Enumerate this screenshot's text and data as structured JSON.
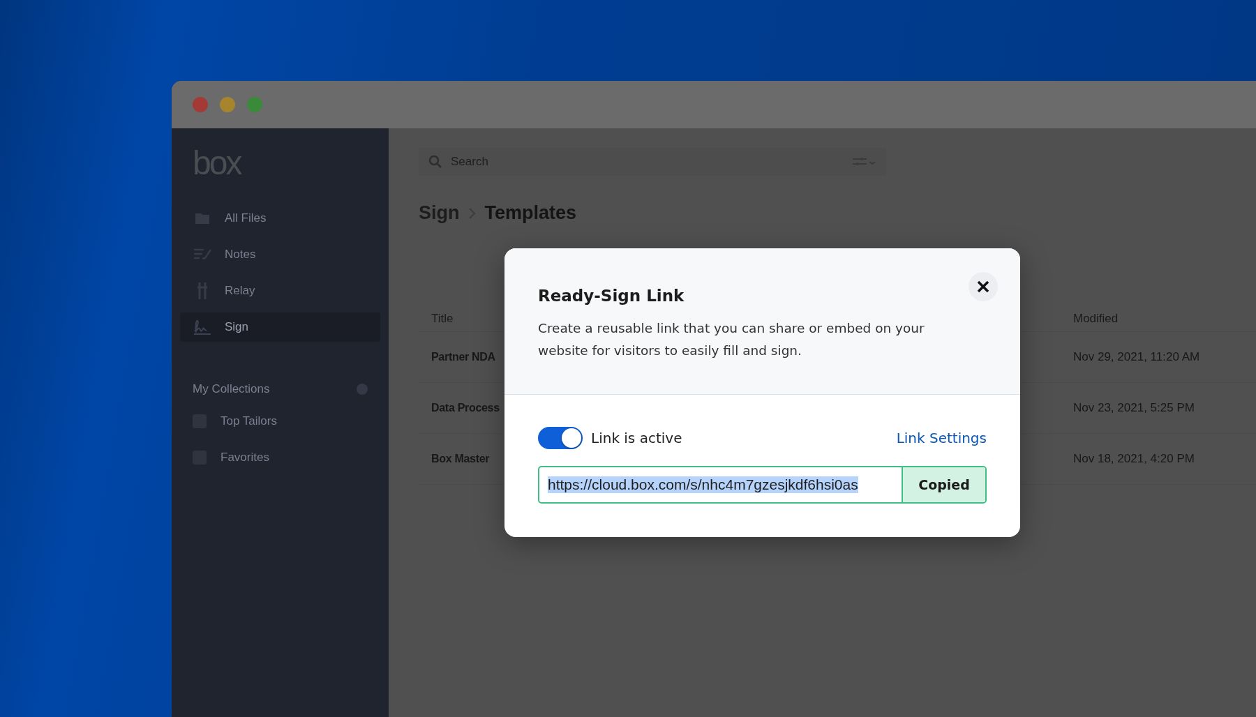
{
  "sidebar": {
    "logo": "box",
    "items": [
      {
        "label": "All Files",
        "selected": false
      },
      {
        "label": "Notes",
        "selected": false
      },
      {
        "label": "Relay",
        "selected": false
      },
      {
        "label": "Sign",
        "selected": true
      }
    ],
    "collections": {
      "title": "My Collections",
      "items": [
        {
          "label": "Top Tailors"
        },
        {
          "label": "Favorites"
        }
      ]
    }
  },
  "main": {
    "search": {
      "placeholder": "Search"
    },
    "breadcrumb": [
      "Sign",
      "Templates"
    ],
    "table": {
      "columns": [
        "Title",
        "Modified"
      ],
      "rows": [
        {
          "title": "Partner NDA",
          "modified": "Nov 29, 2021, 11:20 AM"
        },
        {
          "title": "Data Process",
          "modified": "Nov 23, 2021, 5:25 PM"
        },
        {
          "title": "Box Master",
          "modified": "Nov 18, 2021, 4:20 PM"
        }
      ]
    }
  },
  "modal": {
    "title": "Ready-Sign Link",
    "description": "Create a reusable link that you can share or embed on your website for visitors to easily fill and sign.",
    "toggle": {
      "label": "Link is active",
      "on": true
    },
    "link_settings": "Link Settings",
    "url": {
      "value": "https://cloud.box.com/s/nhc4m7gzesjkdf6hsi0as",
      "text_selected": true
    },
    "copy_button": "Copied"
  }
}
